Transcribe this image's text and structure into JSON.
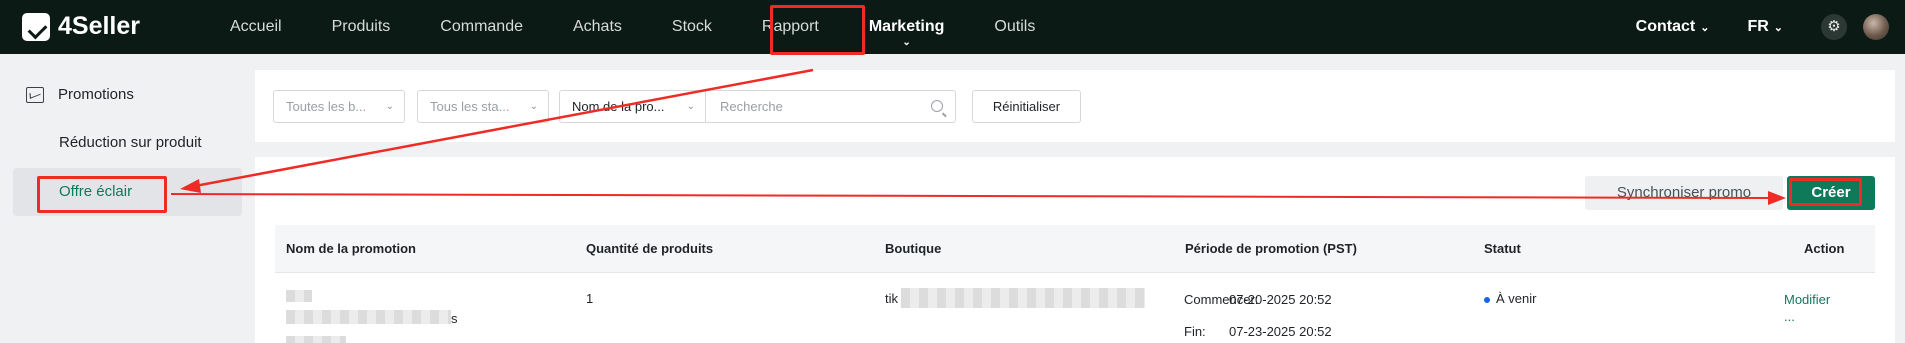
{
  "app": {
    "name": "4Seller"
  },
  "nav": {
    "items": [
      {
        "label": "Accueil",
        "active": false
      },
      {
        "label": "Produits",
        "active": false
      },
      {
        "label": "Commande",
        "active": false
      },
      {
        "label": "Achats",
        "active": false
      },
      {
        "label": "Stock",
        "active": false
      },
      {
        "label": "Rapport",
        "active": false
      },
      {
        "label": "Marketing",
        "active": true
      },
      {
        "label": "Outils",
        "active": false
      }
    ],
    "contact": "Contact",
    "language": "FR"
  },
  "sidebar": {
    "group": "Promotions",
    "items": [
      {
        "label": "Réduction sur produit",
        "active": false
      },
      {
        "label": "Offre éclair",
        "active": true
      }
    ]
  },
  "filters": {
    "shop_select": "Toutes les b...",
    "status_select": "Tous les sta...",
    "field_select": "Nom de la pro...",
    "search_placeholder": "Recherche",
    "reset_label": "Réinitialiser"
  },
  "toolbar": {
    "sync_label": "Synchroniser promo",
    "create_label": "Créer"
  },
  "table": {
    "columns": [
      "Nom de la promotion",
      "Quantité de produits",
      "Boutique",
      "Période de promotion (PST)",
      "Statut",
      "Action"
    ],
    "rows": [
      {
        "name_suffix": "s",
        "quantity": "1",
        "shop_prefix": "tik",
        "start_label": "Commencer:",
        "start": "07-20-2025 20:52",
        "end_label": "Fin:",
        "end": "07-23-2025 20:52",
        "status": "À venir",
        "action": "Modifier",
        "more": "..."
      }
    ]
  },
  "colors": {
    "nav_bg": "#0b1a14",
    "accent": "#0e7a5a",
    "annotation": "#ee2b24",
    "status_dot": "#1a66e0"
  }
}
